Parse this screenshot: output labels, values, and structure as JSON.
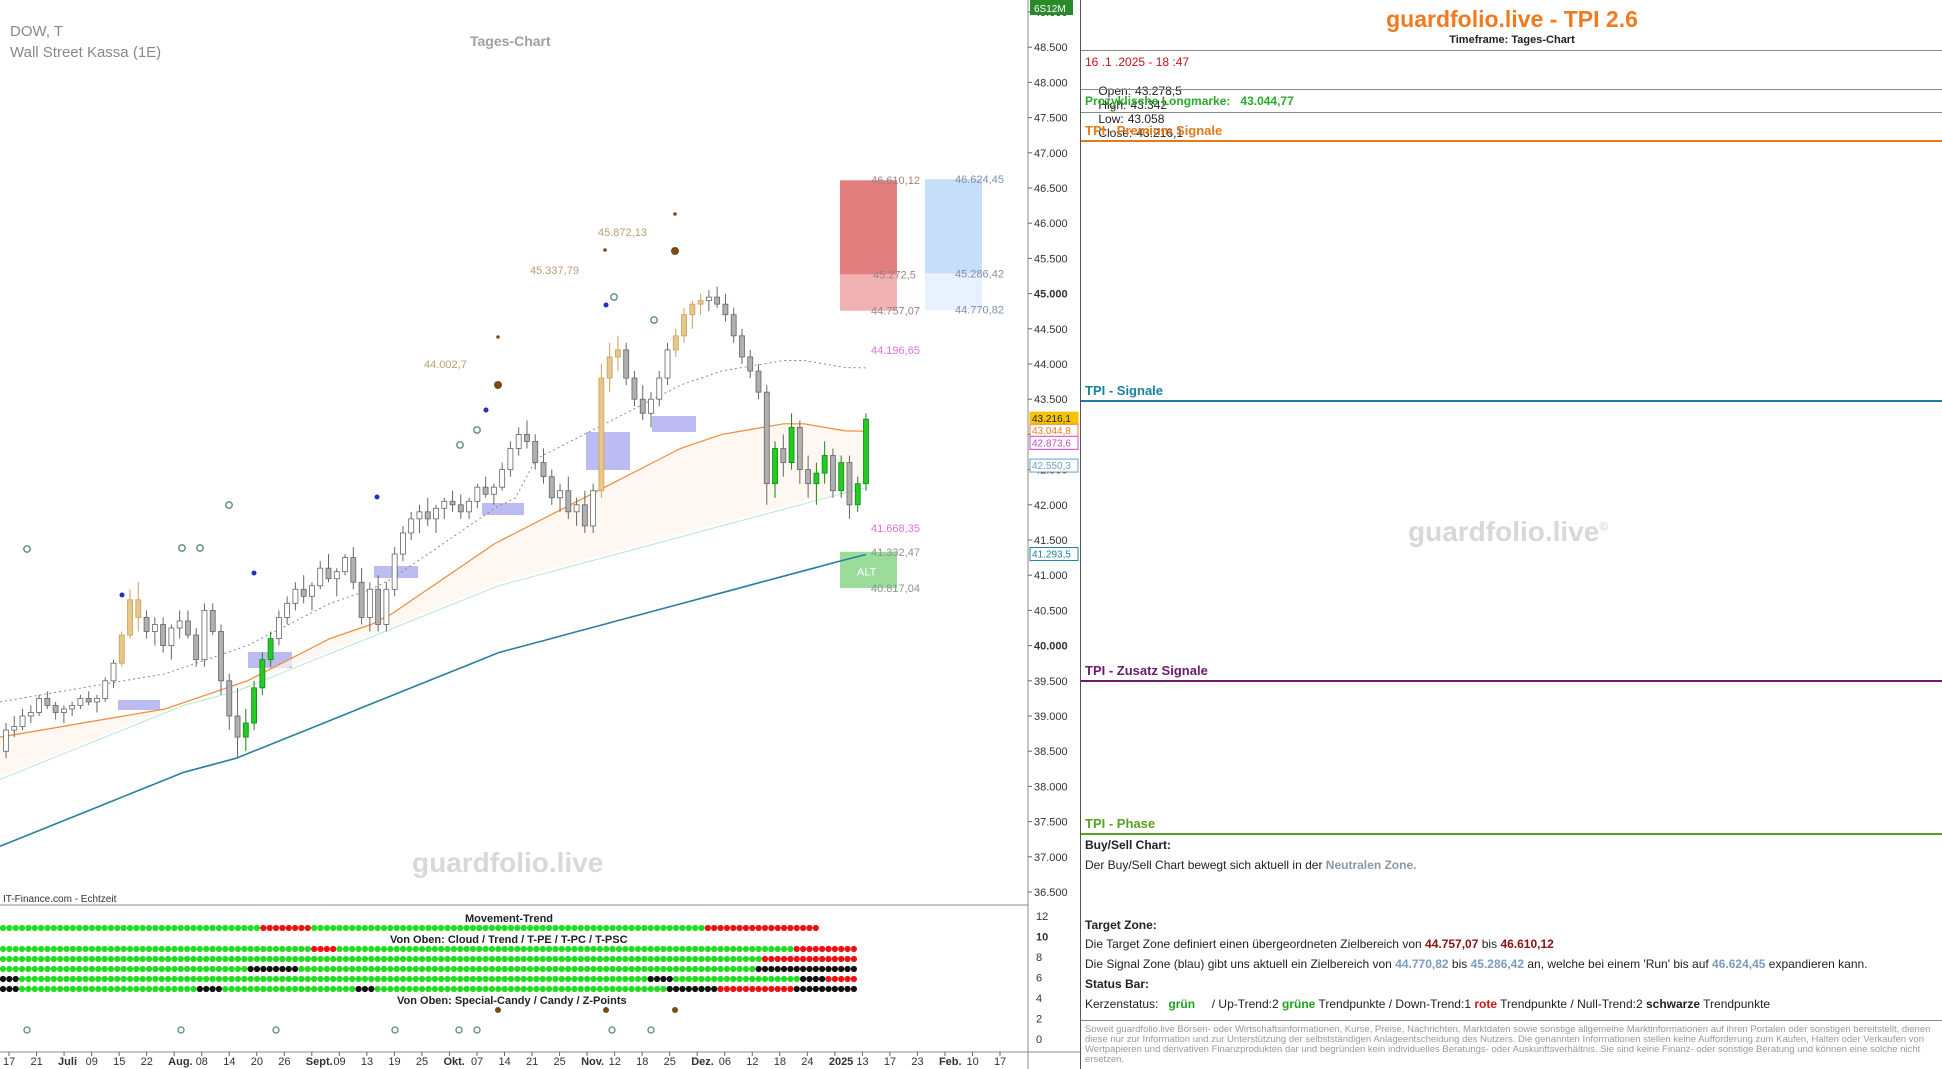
{
  "chart_title": {
    "symbol": "DOW, T",
    "instrument": "Wall Street Kassa (1E)",
    "chart_label": "Tages-Chart",
    "source": "IT-Finance.com - Echtzeit",
    "watermark": "guardfolio.live",
    "mode_label": "6S12M"
  },
  "indicator": {
    "title": "Movement-Trend",
    "sub1": "Von Oben: Cloud / Trend / T-PE / T-PC / T-PSC",
    "sub2": "Von Oben: Special-Candy / Candy / Z-Points",
    "axis_ticks": [
      "12",
      "10",
      "8",
      "6",
      "4",
      "2",
      "0"
    ]
  },
  "price_axis": {
    "ticks": [
      "49.000",
      "48.500",
      "48.000",
      "47.500",
      "47.000",
      "46.500",
      "46.000",
      "45.500",
      "45.000",
      "44.500",
      "44.000",
      "43.500",
      "43.000",
      "42.500",
      "42.000",
      "41.500",
      "41.000",
      "40.500",
      "40.000",
      "39.500",
      "39.000",
      "38.500",
      "38.000",
      "37.500",
      "37.000",
      "36.500"
    ],
    "markers": [
      {
        "label": "43.216,1",
        "value": 43216.1,
        "color": "#f5c400"
      },
      {
        "label": "43.044,8",
        "value": 43044.8,
        "color": "#f07a1f"
      },
      {
        "label": "42.873,6",
        "value": 42873.6,
        "color": "#cc44cc"
      },
      {
        "label": "42.550,3",
        "value": 42550.3,
        "color": "#6aa0c0"
      },
      {
        "label": "41.293,5",
        "value": 41293.5,
        "color": "#1f7fa0"
      }
    ]
  },
  "time_axis": {
    "labels": [
      {
        "t": "17",
        "bold": false
      },
      {
        "t": "21",
        "bold": false
      },
      {
        "t": "Juli",
        "bold": true
      },
      {
        "t": "09",
        "bold": false
      },
      {
        "t": "15",
        "bold": false
      },
      {
        "t": "22",
        "bold": false
      },
      {
        "t": "Aug.",
        "bold": true
      },
      {
        "t": "08",
        "bold": false
      },
      {
        "t": "14",
        "bold": false
      },
      {
        "t": "20",
        "bold": false
      },
      {
        "t": "26",
        "bold": false
      },
      {
        "t": "Sept.",
        "bold": true
      },
      {
        "t": "09",
        "bold": false
      },
      {
        "t": "13",
        "bold": false
      },
      {
        "t": "19",
        "bold": false
      },
      {
        "t": "25",
        "bold": false
      },
      {
        "t": "Okt.",
        "bold": true
      },
      {
        "t": "07",
        "bold": false
      },
      {
        "t": "14",
        "bold": false
      },
      {
        "t": "21",
        "bold": false
      },
      {
        "t": "25",
        "bold": false
      },
      {
        "t": "Nov.",
        "bold": true
      },
      {
        "t": "12",
        "bold": false
      },
      {
        "t": "18",
        "bold": false
      },
      {
        "t": "25",
        "bold": false
      },
      {
        "t": "Dez.",
        "bold": true
      },
      {
        "t": "06",
        "bold": false
      },
      {
        "t": "12",
        "bold": false
      },
      {
        "t": "18",
        "bold": false
      },
      {
        "t": "24",
        "bold": false
      },
      {
        "t": "2025",
        "bold": true
      },
      {
        "t": "13",
        "bold": false
      },
      {
        "t": "17",
        "bold": false
      },
      {
        "t": "23",
        "bold": false
      },
      {
        "t": "Feb.",
        "bold": true
      },
      {
        "t": "10",
        "bold": false
      },
      {
        "t": "17",
        "bold": false
      }
    ]
  },
  "chart_data": {
    "type": "candlestick",
    "ylim": [
      36300,
      49300
    ],
    "price_labels": [
      {
        "text": "44.002,7",
        "value": 44002.7,
        "color": "#b8a070"
      },
      {
        "text": "45.337,79",
        "value": 45337.79,
        "color": "#b8a070"
      },
      {
        "text": "45.872,13",
        "value": 45872.13,
        "color": "#b8a070"
      },
      {
        "text": "46.610,12",
        "value": 46610.12,
        "color": "#a08080"
      },
      {
        "text": "45.272,5",
        "value": 45272.5,
        "color": "#a08080"
      },
      {
        "text": "44.757,07",
        "value": 44757.07,
        "color": "#a08080"
      },
      {
        "text": "46.624,45",
        "value": 46624.45,
        "color": "#8090a8"
      },
      {
        "text": "45.286,42",
        "value": 45286.42,
        "color": "#8090a8"
      },
      {
        "text": "44.770,82",
        "value": 44770.82,
        "color": "#8090a8"
      },
      {
        "text": "44.196,65",
        "value": 44196.65,
        "color": "#e070e0"
      },
      {
        "text": "41.668,35",
        "value": 41668.35,
        "color": "#e070e0"
      },
      {
        "text": "41.332,47",
        "value": 41332.47,
        "color": "#909090"
      },
      {
        "text": "40.817,04",
        "value": 40817.04,
        "color": "#909090"
      },
      {
        "text": "ALT",
        "value": 41050,
        "color": "#ffffff"
      }
    ],
    "zones": [
      {
        "name": "target-zone-upper",
        "from": 45272.5,
        "to": 46610.12,
        "color": "#e07070"
      },
      {
        "name": "target-zone-lower",
        "from": 44757.07,
        "to": 45272.5,
        "color": "#eeaaaa"
      },
      {
        "name": "signal-zone-upper",
        "from": 45286.42,
        "to": 46624.45,
        "color": "#c0daf8"
      },
      {
        "name": "signal-zone-lower",
        "from": 44770.82,
        "to": 45286.42,
        "color": "#e4efff"
      },
      {
        "name": "alt-zone",
        "from": 40817.04,
        "to": 41332.47,
        "color": "#90d890"
      }
    ],
    "candles": [
      [
        38500,
        38900,
        38400,
        38800
      ],
      [
        38800,
        39000,
        38700,
        38850
      ],
      [
        38850,
        39100,
        38800,
        39000
      ],
      [
        39000,
        39150,
        38900,
        39050
      ],
      [
        39050,
        39300,
        39000,
        39250
      ],
      [
        39250,
        39350,
        39100,
        39150
      ],
      [
        39150,
        39200,
        38950,
        39050
      ],
      [
        39050,
        39150,
        38900,
        39100
      ],
      [
        39100,
        39200,
        39000,
        39150
      ],
      [
        39150,
        39300,
        39100,
        39250
      ],
      [
        39250,
        39350,
        39150,
        39200
      ],
      [
        39200,
        39300,
        39050,
        39250
      ],
      [
        39250,
        39550,
        39200,
        39500
      ],
      [
        39500,
        39800,
        39400,
        39750
      ],
      [
        39750,
        40200,
        39700,
        40150
      ],
      [
        40150,
        40800,
        40100,
        40650
      ],
      [
        40650,
        40900,
        40200,
        40400
      ],
      [
        40400,
        40500,
        40100,
        40200
      ],
      [
        40200,
        40400,
        40000,
        40300
      ],
      [
        40300,
        40400,
        39900,
        40000
      ],
      [
        40000,
        40300,
        39800,
        40250
      ],
      [
        40250,
        40500,
        40100,
        40350
      ],
      [
        40350,
        40500,
        40100,
        40150
      ],
      [
        40150,
        40250,
        39700,
        39800
      ],
      [
        39800,
        40600,
        39700,
        40500
      ],
      [
        40500,
        40600,
        40150,
        40200
      ],
      [
        40200,
        40300,
        39300,
        39500
      ],
      [
        39500,
        39600,
        38800,
        39000
      ],
      [
        39000,
        39400,
        38400,
        38700
      ],
      [
        38700,
        39100,
        38500,
        38900
      ],
      [
        38900,
        39500,
        38800,
        39400
      ],
      [
        39400,
        39900,
        39300,
        39800
      ],
      [
        39800,
        40200,
        39700,
        40100
      ],
      [
        40100,
        40500,
        40000,
        40400
      ],
      [
        40400,
        40700,
        40300,
        40600
      ],
      [
        40600,
        40900,
        40500,
        40800
      ],
      [
        40800,
        41000,
        40600,
        40700
      ],
      [
        40700,
        40900,
        40500,
        40850
      ],
      [
        40850,
        41200,
        40800,
        41100
      ],
      [
        41100,
        41300,
        40900,
        40950
      ],
      [
        40950,
        41100,
        40700,
        41050
      ],
      [
        41050,
        41300,
        41000,
        41250
      ],
      [
        41250,
        41400,
        40800,
        40900
      ],
      [
        40900,
        41100,
        40300,
        40400
      ],
      [
        40400,
        40900,
        40200,
        40800
      ],
      [
        40800,
        41000,
        40200,
        40300
      ],
      [
        40300,
        40900,
        40200,
        40800
      ],
      [
        40800,
        41400,
        40700,
        41300
      ],
      [
        41300,
        41700,
        41200,
        41600
      ],
      [
        41600,
        41900,
        41500,
        41800
      ],
      [
        41800,
        42000,
        41600,
        41900
      ],
      [
        41900,
        42100,
        41700,
        41800
      ],
      [
        41800,
        42000,
        41600,
        41950
      ],
      [
        41950,
        42100,
        41800,
        42050
      ],
      [
        42050,
        42200,
        41900,
        42000
      ],
      [
        42000,
        42150,
        41800,
        41900
      ],
      [
        41900,
        42100,
        41800,
        42050
      ],
      [
        42050,
        42300,
        41950,
        42250
      ],
      [
        42250,
        42400,
        42100,
        42150
      ],
      [
        42150,
        42300,
        42000,
        42250
      ],
      [
        42250,
        42600,
        42200,
        42500
      ],
      [
        42500,
        42900,
        42400,
        42800
      ],
      [
        42800,
        43100,
        42700,
        43000
      ],
      [
        43000,
        43200,
        42800,
        42900
      ],
      [
        42900,
        43000,
        42500,
        42600
      ],
      [
        42600,
        42800,
        42300,
        42400
      ],
      [
        42400,
        42500,
        42000,
        42100
      ],
      [
        42100,
        42300,
        41900,
        42200
      ],
      [
        42200,
        42400,
        41800,
        41900
      ],
      [
        41900,
        42100,
        41700,
        42000
      ],
      [
        42000,
        42200,
        41600,
        41700
      ],
      [
        41700,
        42300,
        41600,
        42200
      ],
      [
        42200,
        44000,
        42100,
        43800
      ],
      [
        43800,
        44300,
        43600,
        44100
      ],
      [
        44100,
        44400,
        43900,
        44200
      ],
      [
        44200,
        44300,
        43700,
        43800
      ],
      [
        43800,
        43900,
        43400,
        43500
      ],
      [
        43500,
        43700,
        43200,
        43300
      ],
      [
        43300,
        43600,
        43100,
        43500
      ],
      [
        43500,
        43900,
        43400,
        43800
      ],
      [
        43800,
        44300,
        43700,
        44200
      ],
      [
        44200,
        44500,
        44100,
        44400
      ],
      [
        44400,
        44800,
        44300,
        44700
      ],
      [
        44700,
        44900,
        44500,
        44850
      ],
      [
        44850,
        45000,
        44700,
        44900
      ],
      [
        44900,
        45050,
        44750,
        44950
      ],
      [
        44950,
        45100,
        44800,
        44850
      ],
      [
        44850,
        45000,
        44600,
        44700
      ],
      [
        44700,
        44800,
        44300,
        44400
      ],
      [
        44400,
        44500,
        44000,
        44100
      ],
      [
        44100,
        44200,
        43800,
        43900
      ],
      [
        43900,
        44000,
        43500,
        43600
      ],
      [
        43600,
        43700,
        42000,
        42300
      ],
      [
        42300,
        42900,
        42100,
        42800
      ],
      [
        42800,
        43000,
        42400,
        42600
      ],
      [
        42600,
        43300,
        42500,
        43100
      ],
      [
        43100,
        43200,
        42300,
        42500
      ],
      [
        42500,
        42700,
        42100,
        42300
      ],
      [
        42300,
        42600,
        42000,
        42450
      ],
      [
        42450,
        42900,
        42300,
        42700
      ],
      [
        42700,
        42800,
        42100,
        42200
      ],
      [
        42200,
        42700,
        42100,
        42600
      ],
      [
        42600,
        42700,
        41800,
        42000
      ],
      [
        42000,
        42400,
        41900,
        42300
      ],
      [
        42300,
        43300,
        42200,
        43216
      ]
    ],
    "ma_orange": [
      38700,
      38750,
      38800,
      38850,
      38900,
      38950,
      39000,
      39050,
      39100,
      39200,
      39300,
      39400,
      39500,
      39650,
      39800,
      39950,
      40100,
      40200,
      40300,
      40450,
      40650,
      40850,
      41050,
      41250,
      41450,
      41600,
      41750,
      41900,
      42050,
      42200,
      42350,
      42500,
      42650,
      42800,
      42900,
      43000,
      43050,
      43100,
      43150,
      43150,
      43100,
      43050,
      43044.8
    ],
    "ma_blue": [
      37150,
      37300,
      37450,
      37600,
      37750,
      37900,
      38050,
      38200,
      38300,
      38400,
      38550,
      38700,
      38850,
      39000,
      39150,
      39300,
      39450,
      39600,
      39750,
      39900,
      40000,
      40100,
      40200,
      40300,
      40400,
      40500,
      40600,
      40700,
      40800,
      40900,
      41000,
      41100,
      41200,
      41293.5
    ],
    "indicator_rows": [
      {
        "name": "movement-trend",
        "pattern": "GGGGGGGGGGGGGGGGGGGGGGGGGGGGGGGGGGGGGGGGGGGGGGGGGGGGGGGGGGGGGGGGGGGGGGGGGGGGGGGGGGGGGGGGGGGGGGGGGGGGGGGGGGGGGGGRRRRRRRRRRRRRRRRRR"
      },
      {
        "name": "cloud",
        "pattern": "GGGGGGGGGGGGGGGGGGGGGGGGGGGGGGGGGGGGGGGGGGGGGGGGGGGGGGGGGGGGGGGGGGGGGGGGGGGGGGGGGGGGGGGGGGGGGGGGGGGGGGGGGGGGGGGGGGGGGGGGGGGGGRRRRRRRRRR"
      },
      {
        "name": "trend",
        "pattern": "GGGGGGGGGGGGGGGGGGGGGGGGGGGGGGGGGGGGGGGGGGGGGGGGGGGGGGGGGGGGGGGGGGGGGGGGGGGGGGGGGGGGGGGGGGGGGGGGGGGGGGGGGGGGGGGGGGGGGGGGRRRRRRRRRRRRRRR"
      },
      {
        "name": "t-pe",
        "pattern": "GGGGGGGGGGGGGGGGGGGGGGGGGGGGGGGGGGGGGGGGGGGGGGGGGGGGGGGGGGGGGGGGGGGGGGGGGGGGGGGGGGGGGGGGGGGGGGGGGGGGGGGGGGGGGGGGGGGGGGGGGGGBBBBBBBBBBBB"
      },
      {
        "name": "t-pc",
        "pattern": "GGGGGGGGGGGGGGGGGGGGGGGGGGGGGGGGGGGGGGGGGGGGGGGGGGGGGGGGGGGGGGGGGGGGGGGGGGGGGGGGGGGGGGGGGGGGGGGGGGGGGGGGGGGGGGGGGGGGGGGGGGGGGGGRRRRRRRR"
      },
      {
        "name": "t-psc",
        "pattern": "GGGGGGGGGGGGGGGGGGGGGGGGGGGGGGGGGGGGGGGGGGGGGGGGGGGGGGGGGGGGGGGGGGGGGGGGGGGGGGGGGGGGGGGGGGGGGGGGGGGGGGGGGGGGGGGGGGGGGGGGGBBBBBBBBBBBBBB"
      }
    ]
  },
  "panel": {
    "brand": "guardfolio.live - TPI 2.6",
    "timeframe": "Timeframe: Tages-Chart",
    "datetime": "16 .1 .2025  - 18 :47",
    "open_label": "Open:",
    "open": "43.278,5",
    "high_label": "High:",
    "high": "43.342",
    "low_label": "Low:",
    "low": "43.058",
    "close_label": "Close:",
    "close": "43.216,1",
    "longmarke_label": "Prozyklische Longmarke:",
    "longmarke": "43.044,77",
    "sections": [
      {
        "title": "TPI - Premium Signale",
        "color": "#e07a1a"
      },
      {
        "title": "TPI - Signale",
        "color": "#1a7fa0"
      },
      {
        "title": "TPI - Zusatz Signale",
        "color": "#6a1a6a"
      },
      {
        "title": "TPI - Phase",
        "color": "#5aa020"
      }
    ],
    "watermark": "guardfolio.live",
    "buysell_title": "Buy/Sell Chart:",
    "buysell_text": "Der Buy/Sell Chart bewegt sich aktuell in der",
    "buysell_zone": "Neutralen Zone.",
    "target_title": "Target Zone:",
    "target_text1": "Die Target Zone definiert einen übergeordneten Zielbereich von",
    "target_from": "44.757,07",
    "target_mid": "bis",
    "target_to": "46.610,12",
    "signal_text1": "Die Signal Zone (blau) gibt uns aktuell ein Zielbereich von",
    "signal_from": "44.770,82",
    "signal_mid": "bis",
    "signal_to": "45.286,42",
    "signal_text2": "an, welche bei einem 'Run' bis auf",
    "signal_run": "46.624,45",
    "signal_text3": "expandieren kann.",
    "status_title": "Status Bar:",
    "status_k": "Kerzenstatus:",
    "status_green": "grün",
    "status_up": "/ Up-Trend:2",
    "status_gruene": "grüne",
    "status_tp1": "Trendpunkte  / Down-Trend:1",
    "status_rote": "rote",
    "status_tp2": "Trendpunkte / Null-Trend:2",
    "status_schwarze": "schwarze",
    "status_tp3": "Trendpunkte",
    "disclaimer": "Soweit guardfolio.live Börsen- oder Wirtschaftsinformationen, Kurse, Preise, Nachrichten, Marktdaten sowie sonstige allgemeine Marktinformationen auf ihren Portalen oder sonstigen bereitstellt, dienen diese nur zur Information und zur Unterstützung der selbstständigen Anlageentscheidung des Nutzers. Die genannten Informationen stellen keine Aufforderung zum Kaufen, Halten oder Verkaufen von Wertpapieren und derivativen Finanzprodukten dar und begründen kein individuelles Beratungs- oder Auskunftsverhältnis. Sie sind keine Finanz- oder sonstige Beratung und können eine solche nicht ersetzen."
  }
}
